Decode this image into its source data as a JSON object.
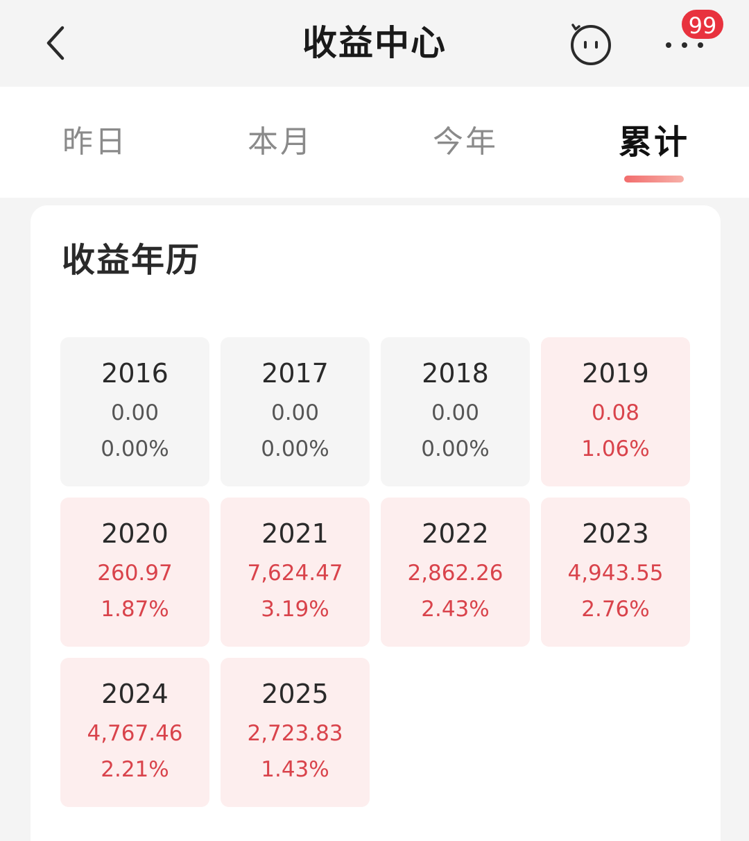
{
  "header": {
    "title": "收益中心",
    "badge_count": "99"
  },
  "tabs": [
    {
      "label": "昨日",
      "active": false
    },
    {
      "label": "本月",
      "active": false
    },
    {
      "label": "今年",
      "active": false
    },
    {
      "label": "累计",
      "active": true
    }
  ],
  "calendar": {
    "title": "收益年历",
    "years": [
      {
        "year": "2016",
        "amount": "0.00",
        "rate": "0.00%",
        "positive": false
      },
      {
        "year": "2017",
        "amount": "0.00",
        "rate": "0.00%",
        "positive": false
      },
      {
        "year": "2018",
        "amount": "0.00",
        "rate": "0.00%",
        "positive": false
      },
      {
        "year": "2019",
        "amount": "0.08",
        "rate": "1.06%",
        "positive": true
      },
      {
        "year": "2020",
        "amount": "260.97",
        "rate": "1.87%",
        "positive": true
      },
      {
        "year": "2021",
        "amount": "7,624.47",
        "rate": "3.19%",
        "positive": true
      },
      {
        "year": "2022",
        "amount": "2,862.26",
        "rate": "2.43%",
        "positive": true
      },
      {
        "year": "2023",
        "amount": "4,943.55",
        "rate": "2.76%",
        "positive": true
      },
      {
        "year": "2024",
        "amount": "4,767.46",
        "rate": "2.21%",
        "positive": true
      },
      {
        "year": "2025",
        "amount": "2,723.83",
        "rate": "1.43%",
        "positive": true
      }
    ]
  },
  "colors": {
    "accent": "#d9434b",
    "badge": "#e8323e",
    "positive_bg": "#fdeeee",
    "neutral_bg": "#f5f5f5"
  },
  "icons": {
    "back": "chevron-left-icon",
    "assistant": "robot-face-icon",
    "more": "more-dots-icon"
  }
}
